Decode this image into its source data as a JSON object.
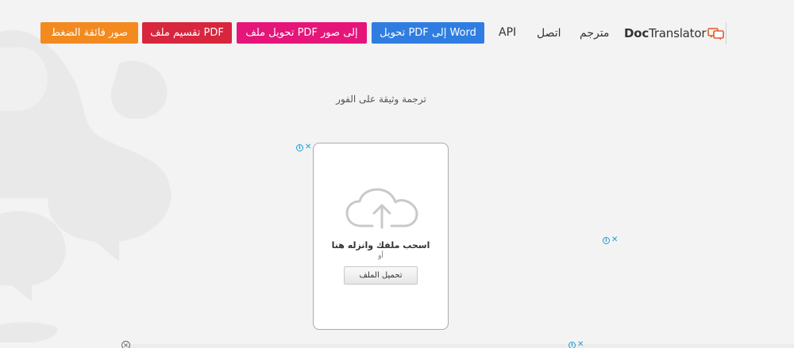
{
  "header": {
    "logo": {
      "text_bold": "Doc",
      "text_regular": "Translator",
      "icon": "speech-bubbles-icon"
    },
    "nav": {
      "translator": "مترجم",
      "contact": "اتصل",
      "api": "API"
    },
    "tools": [
      {
        "label": "تحويل PDF إلى Word",
        "color": "#2f7de1"
      },
      {
        "label": "تحويل ملف PDF إلى صور",
        "color": "#e5157a"
      },
      {
        "label": "تقسيم ملف PDF",
        "color": "#d7263d"
      },
      {
        "label": "صور فائقة الضغط",
        "color": "#f28a1f"
      }
    ]
  },
  "main": {
    "subtitle": "ترجمة وثيقة على الفور",
    "upload": {
      "icon": "cloud-upload-icon",
      "drag_text": "اسحب ملفك وانزله هنا",
      "or_text": "أو",
      "button_label": "تحميل الملف"
    }
  },
  "ads": {
    "info_glyph": "i",
    "close_glyph": "✕",
    "circle_close_glyph": "×",
    "accent": "#1aa0d8"
  }
}
